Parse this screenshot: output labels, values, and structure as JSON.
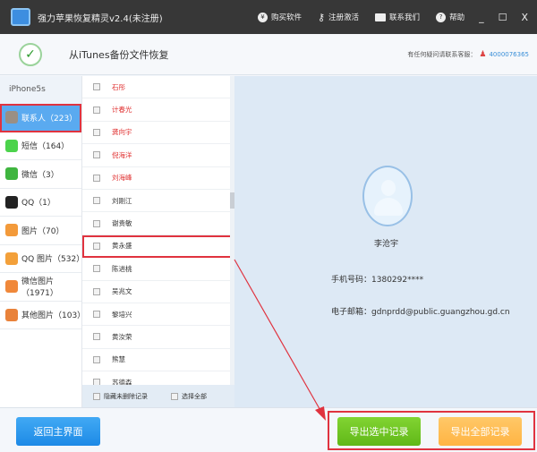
{
  "titlebar": {
    "title": "强力苹果恢复精灵v2.4(未注册)",
    "buttons": [
      "购买软件",
      "注册激活",
      "联系我们",
      "帮助"
    ],
    "controls": [
      "_",
      "☐",
      "X"
    ]
  },
  "header": {
    "title": "从iTunes备份文件恢复",
    "contact_label": "有任何疑问请联系客服：",
    "contact_number": "4000076365"
  },
  "sidebar": {
    "device": "iPhone5s",
    "items": [
      {
        "label": "联系人（223）",
        "color": "#9a8f84"
      },
      {
        "label": "短信（164）",
        "color": "#4cd34c"
      },
      {
        "label": "微信（3）",
        "color": "#3fb53f"
      },
      {
        "label": "QQ（1）",
        "color": "#222"
      },
      {
        "label": "图片（70）",
        "color": "#f39a3a"
      },
      {
        "label": "QQ 图片（532）",
        "color": "#f3a03a"
      },
      {
        "label": "微信图片（1971）",
        "color": "#f0883a"
      },
      {
        "label": "其他图片（103）",
        "color": "#e9823a"
      }
    ]
  },
  "list": {
    "rows": [
      {
        "name": "石彤",
        "deleted": true
      },
      {
        "name": "计春光",
        "deleted": true
      },
      {
        "name": "龚向宇",
        "deleted": true
      },
      {
        "name": "倪海洋",
        "deleted": true
      },
      {
        "name": "刘海峰",
        "deleted": true
      },
      {
        "name": "刘刚江",
        "deleted": false
      },
      {
        "name": "谢贵敏",
        "deleted": false
      },
      {
        "name": "黄永盛",
        "deleted": false
      },
      {
        "name": "陈进桃",
        "deleted": false
      },
      {
        "name": "吴兆文",
        "deleted": false
      },
      {
        "name": "黎培兴",
        "deleted": false
      },
      {
        "name": "黄汝荣",
        "deleted": false
      },
      {
        "name": "熊慧",
        "deleted": false
      },
      {
        "name": "苏德森",
        "deleted": false
      }
    ],
    "hide_undeleted": "隐藏未删除记录",
    "select_all": "选择全部"
  },
  "detail": {
    "name": "李沧宇",
    "phone_label": "手机号码：",
    "phone": "1380292****",
    "email_label": "电子邮箱：",
    "email": "gdnprdd@public.guangzhou.gd.cn"
  },
  "bottom": {
    "back": "返回主界面",
    "export_selected": "导出选中记录",
    "export_all": "导出全部记录"
  }
}
